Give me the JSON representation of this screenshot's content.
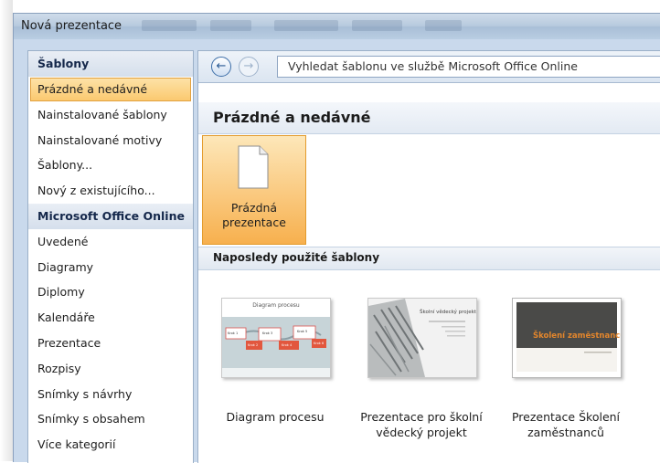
{
  "window": {
    "title": "Nová prezentace"
  },
  "sidebar": {
    "items": [
      {
        "label": "Šablony",
        "kind": "header"
      },
      {
        "label": "Prázdné a nedávné",
        "kind": "selected"
      },
      {
        "label": "Nainstalované šablony",
        "kind": "item"
      },
      {
        "label": "Nainstalované motivy",
        "kind": "item"
      },
      {
        "label": "Šablony...",
        "kind": "item"
      },
      {
        "label": "Nový z existujícího...",
        "kind": "item"
      },
      {
        "label": "Microsoft Office Online",
        "kind": "header"
      },
      {
        "label": "Uvedené",
        "kind": "item"
      },
      {
        "label": "Diagramy",
        "kind": "item"
      },
      {
        "label": "Diplomy",
        "kind": "item"
      },
      {
        "label": "Kalendáře",
        "kind": "item"
      },
      {
        "label": "Prezentace",
        "kind": "item"
      },
      {
        "label": "Rozpisy",
        "kind": "item"
      },
      {
        "label": "Snímky s návrhy",
        "kind": "item"
      },
      {
        "label": "Snímky s obsahem",
        "kind": "item"
      },
      {
        "label": "Více kategorií",
        "kind": "item"
      }
    ]
  },
  "toolbar": {
    "back_icon": "back-arrow-icon",
    "forward_icon": "forward-arrow-icon",
    "search_value": "Vyhledat šablonu ve službě Microsoft Office Online"
  },
  "main": {
    "section_title": "Prázdné a nedávné",
    "blank": {
      "label_line1": "Prázdná",
      "label_line2": "prezentace"
    },
    "recent_title": "Naposledy použité šablony",
    "recent": [
      {
        "label_line1": "Diagram procesu",
        "label_line2": "",
        "thumb_title": "Diagram procesu",
        "thumb_steps": [
          "Krok 1",
          "Krok 2",
          "Krok 3",
          "Krok 4",
          "Krok 5",
          "Krok 6"
        ]
      },
      {
        "label_line1": "Prezentace pro školní",
        "label_line2": "vědecký projekt",
        "thumb_title": "Školní vědecký projekt"
      },
      {
        "label_line1": "Prezentace Školení",
        "label_line2": "zaměstnanců",
        "thumb_title": "Školení zaměstnanců"
      }
    ]
  },
  "colors": {
    "accent_orange": "#f7b04e",
    "dialog_bg": "#c9d9ec",
    "selection": "#fbc970"
  }
}
